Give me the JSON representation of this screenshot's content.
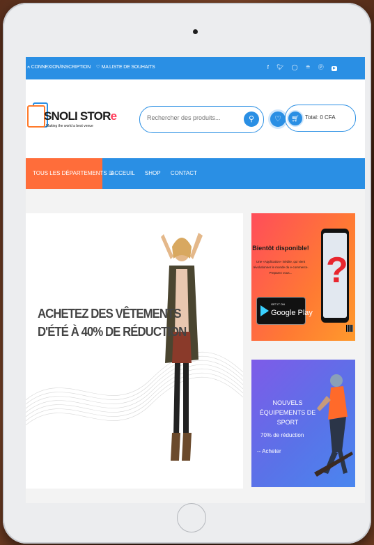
{
  "topbar": {
    "login_label": "⍲ CONNEXION/INSCRIPTION",
    "wishlist_label": "♡ MA LISTE DE SOUHAITS",
    "social": [
      "f",
      " 𝕏",
      "◎",
      ")",
      "℗",
      "▶"
    ]
  },
  "header": {
    "logo_text": "SNOLI STOR",
    "logo_accent": "e",
    "tagline": "Making the world a best venue",
    "search_placeholder": "Rechercher des produits...",
    "cart_total": "Total: 0 CFA"
  },
  "nav": {
    "departments": "TOUS LES DÉPARTEMENTS ☰",
    "links": [
      "ACCEUIL",
      "SHOP",
      "CONTACT"
    ]
  },
  "hero": {
    "line1": "ACHETEZ DES VÊTEMENTS",
    "line2": "D'ÉTÉ À 40% DE RÉDUCTION"
  },
  "promo_app": {
    "title": "Bientôt disponible!",
    "subtitle": "Une «Application» inédite, qui vient révolutionner le monde du e-commerce. Preparez vous...",
    "store_small": "GET IT ON",
    "store_name": "Google Play"
  },
  "promo_sport": {
    "title": "NOUVELS ÉQUIPEMENTS DE SPORT",
    "discount": "70% de réduction",
    "cta": "-- Acheter"
  },
  "colors": {
    "primary": "#2a8fe4",
    "accent": "#ff6d3a"
  }
}
